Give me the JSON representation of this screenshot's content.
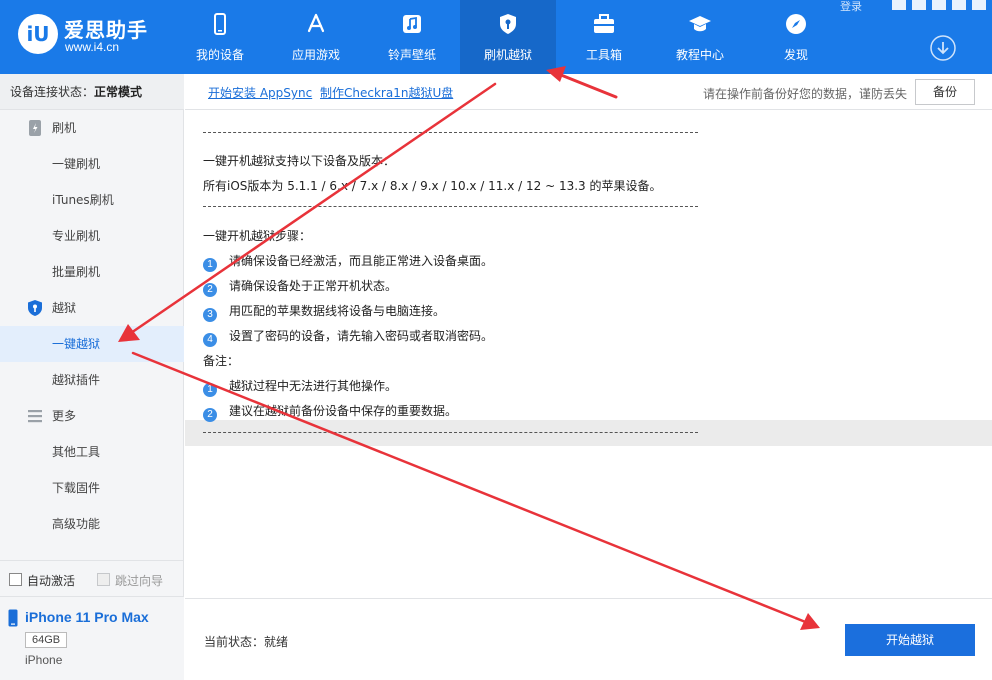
{
  "app": {
    "logo_mark": "iU",
    "title": "爱思助手",
    "url": "www.i4.cn",
    "login": "登录"
  },
  "nav": [
    {
      "label": "我的设备",
      "icon": "phone-icon"
    },
    {
      "label": "应用游戏",
      "icon": "app-store-icon"
    },
    {
      "label": "铃声壁纸",
      "icon": "music-icon"
    },
    {
      "label": "刷机越狱",
      "icon": "shield-key-icon",
      "active": true
    },
    {
      "label": "工具箱",
      "icon": "toolbox-icon"
    },
    {
      "label": "教程中心",
      "icon": "graduation-cap-icon"
    },
    {
      "label": "发现",
      "icon": "compass-icon"
    }
  ],
  "sidebar": {
    "status_label": "设备连接状态：",
    "status_value": "正常模式",
    "groups": [
      {
        "label": "刷机",
        "icon": "flash-icon",
        "items": [
          "一键刷机",
          "iTunes刷机",
          "专业刷机",
          "批量刷机"
        ]
      },
      {
        "label": "越狱",
        "icon": "jailbreak-shield-icon",
        "items": [
          "一键越狱",
          "越狱插件"
        ]
      },
      {
        "label": "更多",
        "icon": "menu-lines-icon",
        "items": [
          "其他工具",
          "下载固件",
          "高级功能"
        ]
      }
    ],
    "active_item": "一键越狱",
    "auto_activate": "自动激活",
    "skip_guide": "跳过向导"
  },
  "device": {
    "name": "iPhone 11 Pro Max",
    "capacity": "64GB",
    "type": "iPhone"
  },
  "toolbar": {
    "link1": "开始安装 AppSync",
    "link2": "制作Checkra1n越狱U盘",
    "tip": "请在操作前备份好您的数据，谨防丢失",
    "backup": "备份"
  },
  "info": {
    "support_title": "一键开机越狱支持以下设备及版本：",
    "support_text": "所有iOS版本为 5.1.1 / 6.x / 7.x / 8.x / 9.x / 10.x / 11.x / 12 ~ 13.3 的苹果设备。",
    "steps_title": "一键开机越狱步骤：",
    "steps": [
      "请确保设备已经激活，而且能正常进入设备桌面。",
      "请确保设备处于正常开机状态。",
      "用匹配的苹果数据线将设备与电脑连接。",
      "设置了密码的设备，请先输入密码或者取消密码。"
    ],
    "notes_title": "备注：",
    "notes": [
      "越狱过程中无法进行其他操作。",
      "建议在越狱前备份设备中保存的重要数据。"
    ]
  },
  "bottom": {
    "state_label": "当前状态：",
    "state_value": "就绪",
    "start": "开始越狱"
  },
  "colors": {
    "brand": "#1a7ae8",
    "nav_active": "#1668c9",
    "link": "#1a6ed8",
    "annotation_arrow": "#e8333a"
  }
}
